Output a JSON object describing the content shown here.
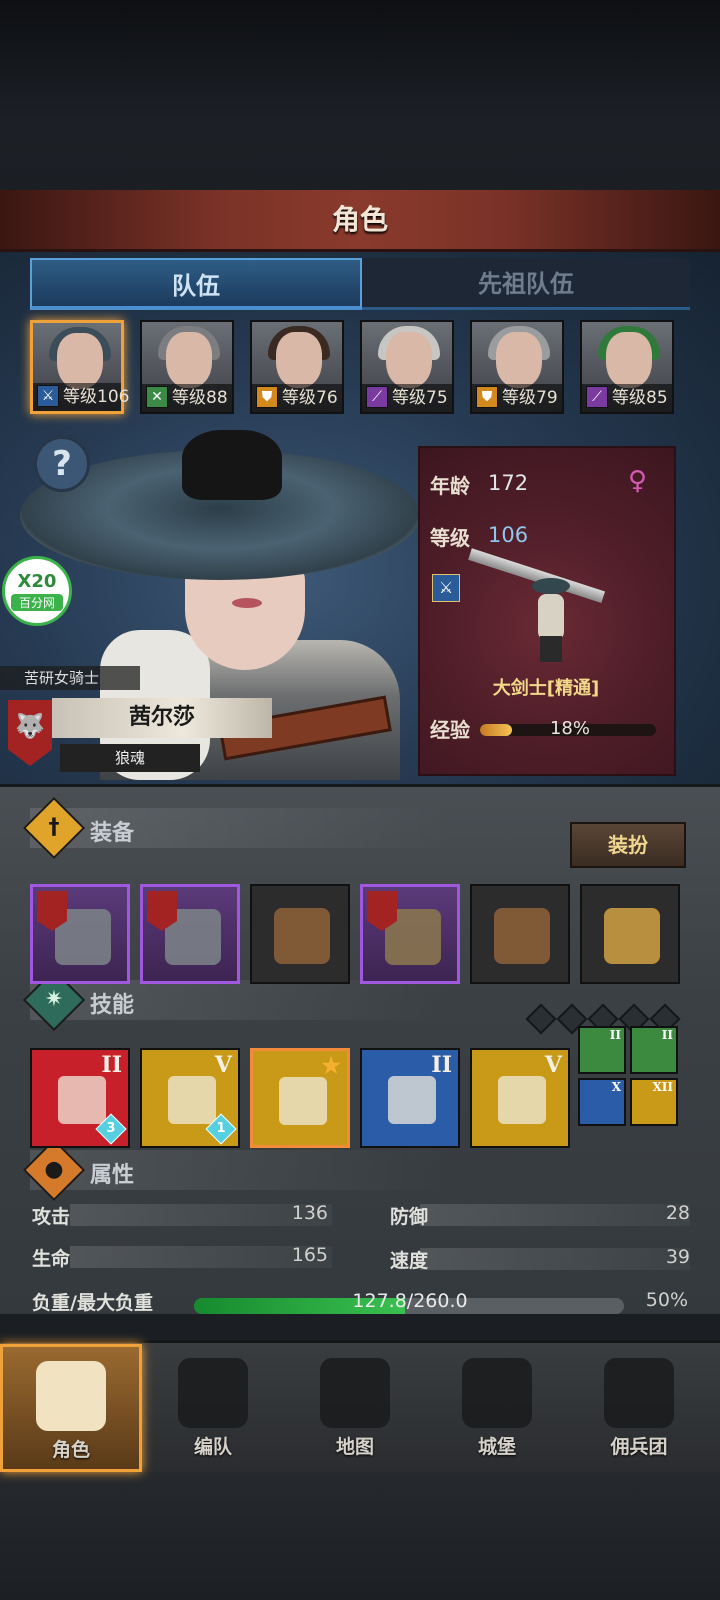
{
  "window": {
    "title": "角色"
  },
  "tabs": [
    {
      "label": "队伍",
      "active": true
    },
    {
      "label": "先祖队伍",
      "active": false
    }
  ],
  "team": [
    {
      "level_label": "等级106",
      "class_icon": "sword-icon",
      "class_color": "#2a5c9a",
      "hair": "#3b4d58",
      "selected": true
    },
    {
      "level_label": "等级88",
      "class_icon": "bow-icon",
      "class_color": "#3b8a45",
      "hair": "#7c7d80",
      "selected": false
    },
    {
      "level_label": "等级76",
      "class_icon": "shield-icon",
      "class_color": "#d4891e",
      "hair": "#3a2a22",
      "selected": false
    },
    {
      "level_label": "等级75",
      "class_icon": "staff-icon",
      "class_color": "#7a3aa0",
      "hair": "#c8c6c2",
      "selected": false
    },
    {
      "level_label": "等级79",
      "class_icon": "shield-icon",
      "class_color": "#d4891e",
      "hair": "#9a9c9e",
      "selected": false
    },
    {
      "level_label": "等级85",
      "class_icon": "staff-icon",
      "class_color": "#7a3aa0",
      "hair": "#2f7a3a",
      "selected": false
    }
  ],
  "character": {
    "subtitle": "苦研女骑士",
    "name": "茜尔莎",
    "title": "狼魂",
    "age_label": "年龄",
    "age": "172",
    "level_label": "等级",
    "level": "106",
    "class_name": "大剑士[精通]",
    "exp_label": "经验",
    "exp_pct": "18%",
    "exp_fraction": 0.18,
    "gender_icon": "female-icon"
  },
  "help_icon": "?",
  "watermark": {
    "top": "X20",
    "bottom": "百分网"
  },
  "equipment": {
    "title": "装备",
    "button": "装扮",
    "slots": [
      {
        "name": "greatsword",
        "rarity": "purple",
        "bg": "#7a7f86"
      },
      {
        "name": "greatsword",
        "rarity": "purple",
        "bg": "#7a7f86"
      },
      {
        "name": "helmet",
        "rarity": "normal",
        "bg": "#8a5e38"
      },
      {
        "name": "armor",
        "rarity": "purple",
        "bg": "#8a7450"
      },
      {
        "name": "boots",
        "rarity": "normal",
        "bg": "#8a5e38"
      },
      {
        "name": "amulet",
        "rarity": "normal",
        "bg": "#c89a40"
      }
    ]
  },
  "skills": {
    "title": "技能",
    "diamonds": 5,
    "main": [
      {
        "rank": "II",
        "gem": "3",
        "bg": "#c8202a"
      },
      {
        "rank": "V",
        "gem": "1",
        "bg": "#c89a18"
      },
      {
        "rank": "",
        "gem": "",
        "bg": "#c89a18",
        "selected": true
      },
      {
        "rank": "II",
        "gem": "",
        "bg": "#2a5ca8"
      },
      {
        "rank": "V",
        "gem": "",
        "bg": "#c89a18"
      }
    ],
    "mini": [
      {
        "rank": "II",
        "bg": "#3c8a40"
      },
      {
        "rank": "II",
        "bg": "#3c8a40"
      },
      {
        "rank": "X",
        "bg": "#2a5ca8"
      },
      {
        "rank": "XII",
        "bg": "#c89a18"
      }
    ]
  },
  "attributes": {
    "title": "属性",
    "attack_label": "攻击",
    "attack": "136",
    "defense_label": "防御",
    "defense": "28",
    "hp_label": "生命",
    "hp": "165",
    "speed_label": "速度",
    "speed": "39",
    "load_label": "负重/最大负重",
    "load_value": "127.8/260.0",
    "load_pct": "50%",
    "load_fraction": 0.49
  },
  "nav": [
    {
      "label": "角色",
      "active": true
    },
    {
      "label": "编队",
      "active": false
    },
    {
      "label": "地图",
      "active": false
    },
    {
      "label": "城堡",
      "active": false
    },
    {
      "label": "佣兵团",
      "active": false
    }
  ],
  "colors": {
    "accent": "#f0a23a",
    "title_bar": "#8a3a2c",
    "purple_rarity": "#a158e0",
    "load_green": "#3ac050"
  }
}
